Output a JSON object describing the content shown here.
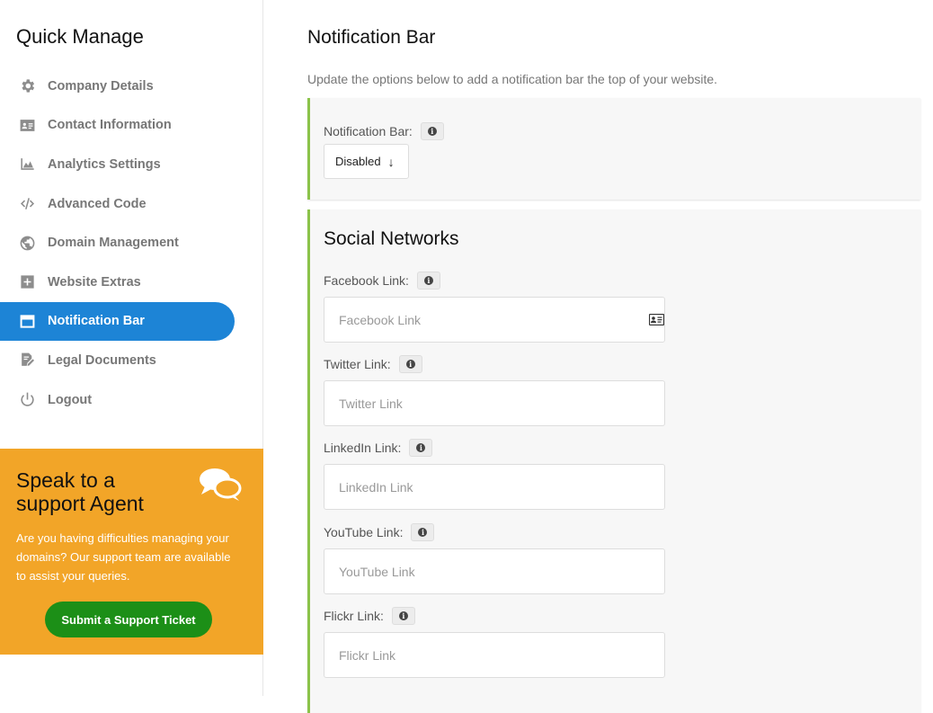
{
  "sidebar": {
    "title": "Quick Manage",
    "items": [
      {
        "label": "Company Details",
        "icon": "gear-icon"
      },
      {
        "label": "Contact Information",
        "icon": "contact-card-icon"
      },
      {
        "label": "Analytics Settings",
        "icon": "area-chart-icon"
      },
      {
        "label": "Advanced Code",
        "icon": "code-icon"
      },
      {
        "label": "Domain Management",
        "icon": "globe-icon"
      },
      {
        "label": "Website Extras",
        "icon": "plus-square-icon"
      },
      {
        "label": "Notification Bar",
        "icon": "window-icon",
        "active": true
      },
      {
        "label": "Legal Documents",
        "icon": "signature-icon"
      },
      {
        "label": "Logout",
        "icon": "power-icon"
      }
    ],
    "support": {
      "title": "Speak to a support Agent",
      "text": "Are you having difficulties managing your domains? Our support team are available to assist your queries.",
      "button": "Submit a Support Ticket",
      "icon": "chat-bubbles-icon"
    }
  },
  "main": {
    "title": "Notification Bar",
    "subtitle": "Update the options below to add a notification bar the top of your website.",
    "notification": {
      "label": "Notification Bar:",
      "value": "Disabled"
    },
    "social": {
      "title": "Social Networks",
      "fields": [
        {
          "label": "Facebook Link:",
          "placeholder": "Facebook Link"
        },
        {
          "label": "Twitter Link:",
          "placeholder": "Twitter Link"
        },
        {
          "label": "LinkedIn Link:",
          "placeholder": "LinkedIn Link"
        },
        {
          "label": "YouTube Link:",
          "placeholder": "YouTube Link"
        },
        {
          "label": "Flickr Link:",
          "placeholder": "Flickr Link"
        }
      ]
    }
  },
  "colors": {
    "active_nav": "#1d84d6",
    "support_bg": "#f2a528",
    "support_button": "#1c8f17",
    "panel_accent": "#8bc34a"
  }
}
